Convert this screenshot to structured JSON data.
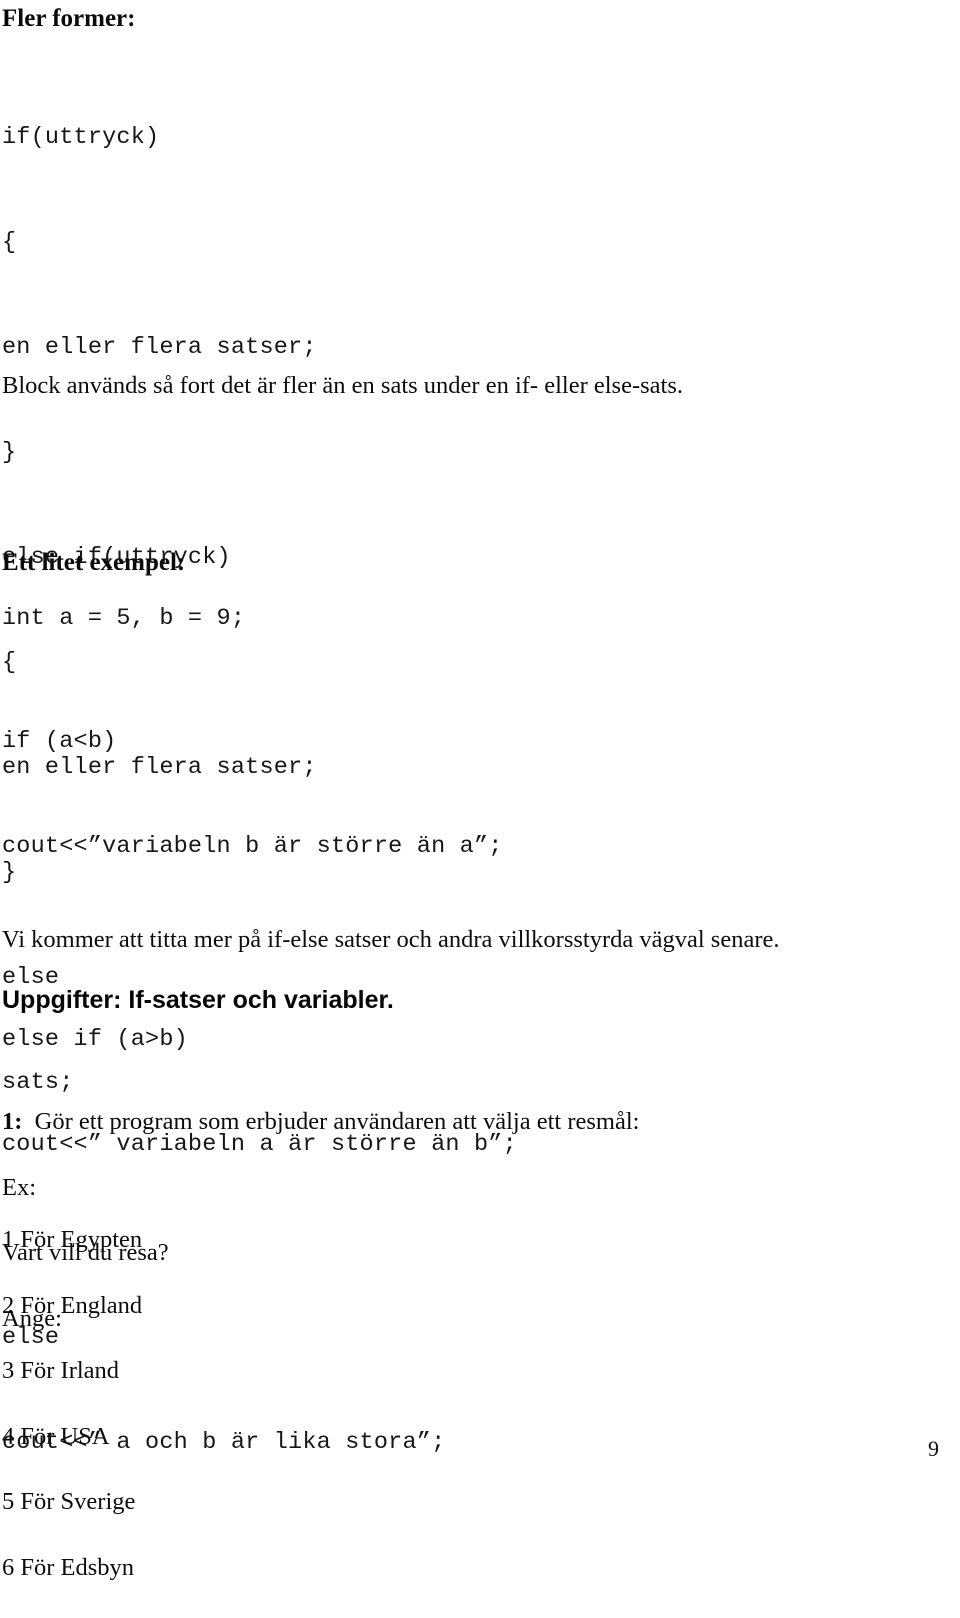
{
  "document": {
    "language": "sv",
    "page_number": "9"
  },
  "sections": {
    "fler_former": {
      "heading": "Fler former:",
      "code_lines": [
        "if(uttryck)",
        "{",
        "en eller flera satser;",
        "}",
        "else if(uttryck)",
        "{",
        "en eller flera satser;",
        "}",
        "else",
        "sats;"
      ]
    },
    "block_note": {
      "text": "Block används så fort det är fler än en sats under en if- eller else-sats."
    },
    "ett_litet_exempel": {
      "heading": "Ett litet exempel:",
      "declaration": "int a = 5, b = 9;",
      "code_lines": [
        "if (a<b)",
        "cout<<”variabeln b är större än a”;",
        "",
        "else if (a>b)",
        "cout<<” variabeln a är större än b”;",
        "",
        "else",
        "cout<<” a och b är lika stora”;"
      ]
    },
    "closing_note": {
      "text": "Vi kommer att titta mer på if-else satser och andra villkorsstyrda vägval senare."
    },
    "uppgifter": {
      "heading": "Uppgifter: If-satser och variabler.",
      "task_number": "1:",
      "task_text": "Gör ett program som erbjuder användaren att välja ett resmål:",
      "example_label": "Ex:",
      "prompt_question": "Vart vill du resa?",
      "prompt_ange": "Ange:",
      "destinations": [
        "1 För Egypten",
        "2 För England",
        "3 För Irland",
        "4 För USA",
        "5 För Sverige",
        "6 För Edsbyn"
      ]
    }
  }
}
